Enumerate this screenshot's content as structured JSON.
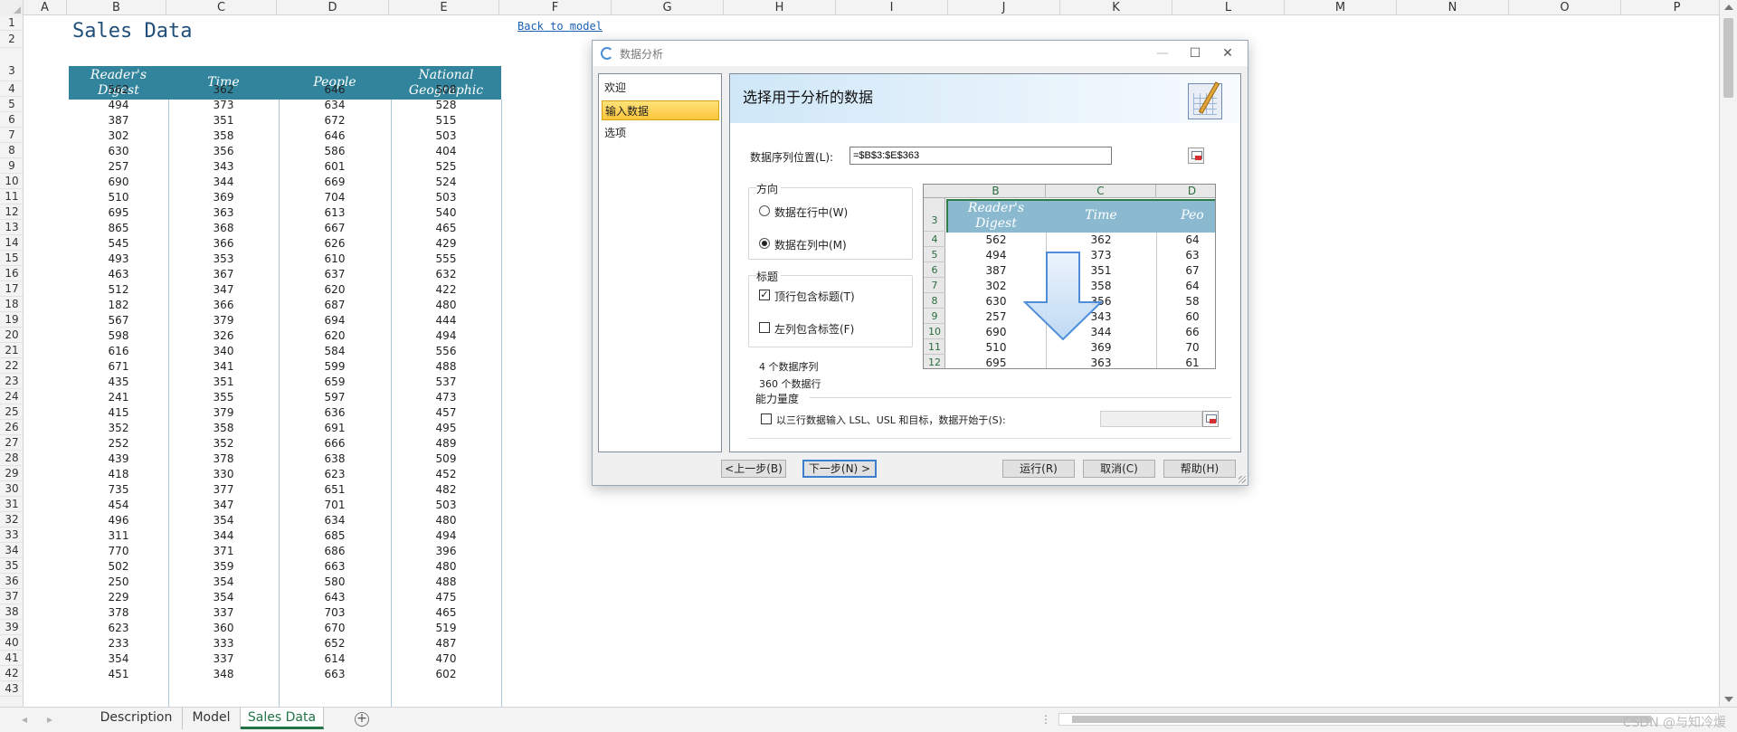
{
  "spreadsheet": {
    "columns": [
      "A",
      "B",
      "C",
      "D",
      "E",
      "F",
      "G",
      "H",
      "I",
      "J",
      "K",
      "L",
      "M",
      "N",
      "O",
      "P"
    ],
    "row_numbers": [
      "1",
      "2",
      "3",
      "4",
      "5",
      "6",
      "7",
      "8",
      "9",
      "10",
      "11",
      "12",
      "13",
      "14",
      "15",
      "16",
      "17",
      "18",
      "19",
      "20",
      "21",
      "22",
      "23",
      "24",
      "25",
      "26",
      "27",
      "28",
      "29",
      "30",
      "31",
      "32",
      "33",
      "34",
      "35",
      "36",
      "37",
      "38",
      "39",
      "40",
      "41",
      "42",
      "43"
    ],
    "title": "Sales Data",
    "back_link": "Back to model",
    "table_headers": [
      "Reader's Digest",
      "Time",
      "People",
      "National Geographic"
    ],
    "rows": [
      [
        "562",
        "362",
        "646",
        "508"
      ],
      [
        "494",
        "373",
        "634",
        "528"
      ],
      [
        "387",
        "351",
        "672",
        "515"
      ],
      [
        "302",
        "358",
        "646",
        "503"
      ],
      [
        "630",
        "356",
        "586",
        "404"
      ],
      [
        "257",
        "343",
        "601",
        "525"
      ],
      [
        "690",
        "344",
        "669",
        "524"
      ],
      [
        "510",
        "369",
        "704",
        "503"
      ],
      [
        "695",
        "363",
        "613",
        "540"
      ],
      [
        "865",
        "368",
        "667",
        "465"
      ],
      [
        "545",
        "366",
        "626",
        "429"
      ],
      [
        "493",
        "353",
        "610",
        "555"
      ],
      [
        "463",
        "367",
        "637",
        "632"
      ],
      [
        "512",
        "347",
        "620",
        "422"
      ],
      [
        "182",
        "366",
        "687",
        "480"
      ],
      [
        "567",
        "379",
        "694",
        "444"
      ],
      [
        "598",
        "326",
        "620",
        "494"
      ],
      [
        "616",
        "340",
        "584",
        "556"
      ],
      [
        "671",
        "341",
        "599",
        "488"
      ],
      [
        "435",
        "351",
        "659",
        "537"
      ],
      [
        "241",
        "355",
        "597",
        "473"
      ],
      [
        "415",
        "379",
        "636",
        "457"
      ],
      [
        "352",
        "358",
        "691",
        "495"
      ],
      [
        "252",
        "352",
        "666",
        "489"
      ],
      [
        "439",
        "378",
        "638",
        "509"
      ],
      [
        "418",
        "330",
        "623",
        "452"
      ],
      [
        "735",
        "377",
        "651",
        "482"
      ],
      [
        "454",
        "347",
        "701",
        "503"
      ],
      [
        "496",
        "354",
        "634",
        "480"
      ],
      [
        "311",
        "344",
        "685",
        "494"
      ],
      [
        "770",
        "371",
        "686",
        "396"
      ],
      [
        "502",
        "359",
        "663",
        "480"
      ],
      [
        "250",
        "354",
        "580",
        "488"
      ],
      [
        "229",
        "354",
        "643",
        "475"
      ],
      [
        "378",
        "337",
        "703",
        "465"
      ],
      [
        "623",
        "360",
        "670",
        "519"
      ],
      [
        "233",
        "333",
        "652",
        "487"
      ],
      [
        "354",
        "337",
        "614",
        "470"
      ],
      [
        "451",
        "348",
        "663",
        "602"
      ]
    ]
  },
  "tabs": {
    "items": [
      "Description",
      "Model",
      "Sales Data"
    ],
    "active": "Sales Data",
    "add_symbol": "+",
    "nav_prev": "◂",
    "nav_next": "▸",
    "more": "⋮"
  },
  "watermark": "CSDN @与知冷煖",
  "dialog": {
    "title": "数据分析",
    "window_controls": {
      "minimize": "—",
      "maximize": "☐",
      "close": "✕"
    },
    "nav_items": [
      "欢迎",
      "输入数据",
      "选项"
    ],
    "active_nav": "输入数据",
    "heading": "选择用于分析的数据",
    "range_label": "数据序列位置(L):",
    "range_value": "=$B$3:$E$363",
    "direction": {
      "title": "方向",
      "options": [
        "数据在行中(W)",
        "数据在列中(M)"
      ],
      "selected": "数据在列中(M)"
    },
    "headers_group": {
      "title": "标题",
      "options": [
        {
          "label": "顶行包含标题(T)",
          "checked": true
        },
        {
          "label": "左列包含标签(F)",
          "checked": false
        }
      ]
    },
    "summary": [
      "4 个数据序列",
      "360 个数据行"
    ],
    "capability": {
      "title": "能力量度",
      "checkbox_label": "以三行数据输入 LSL、USL 和目标，数据开始于(S):",
      "checked": false
    },
    "preview": {
      "columns": [
        "B",
        "C",
        "D"
      ],
      "row_numbers": [
        "3",
        "4",
        "5",
        "6",
        "7",
        "8",
        "9",
        "10",
        "11",
        "12"
      ],
      "headers": [
        "Reader's Digest",
        "Time",
        "Peo"
      ],
      "rows": [
        [
          "562",
          "362",
          "64"
        ],
        [
          "494",
          "373",
          "63"
        ],
        [
          "387",
          "351",
          "67"
        ],
        [
          "302",
          "358",
          "64"
        ],
        [
          "630",
          "356",
          "58"
        ],
        [
          "257",
          "343",
          "60"
        ],
        [
          "690",
          "344",
          "66"
        ],
        [
          "510",
          "369",
          "70"
        ],
        [
          "695",
          "363",
          "61"
        ]
      ]
    },
    "buttons": {
      "back": "<上一步(B)",
      "next": "下一步(N) >",
      "run": "运行(R)",
      "cancel": "取消(C)",
      "help": "帮助(H)"
    }
  },
  "colors": {
    "table_header": "#31849b",
    "title_text": "#1f4e79",
    "active_tab": "#217346",
    "active_nav": "#fcc63b"
  }
}
